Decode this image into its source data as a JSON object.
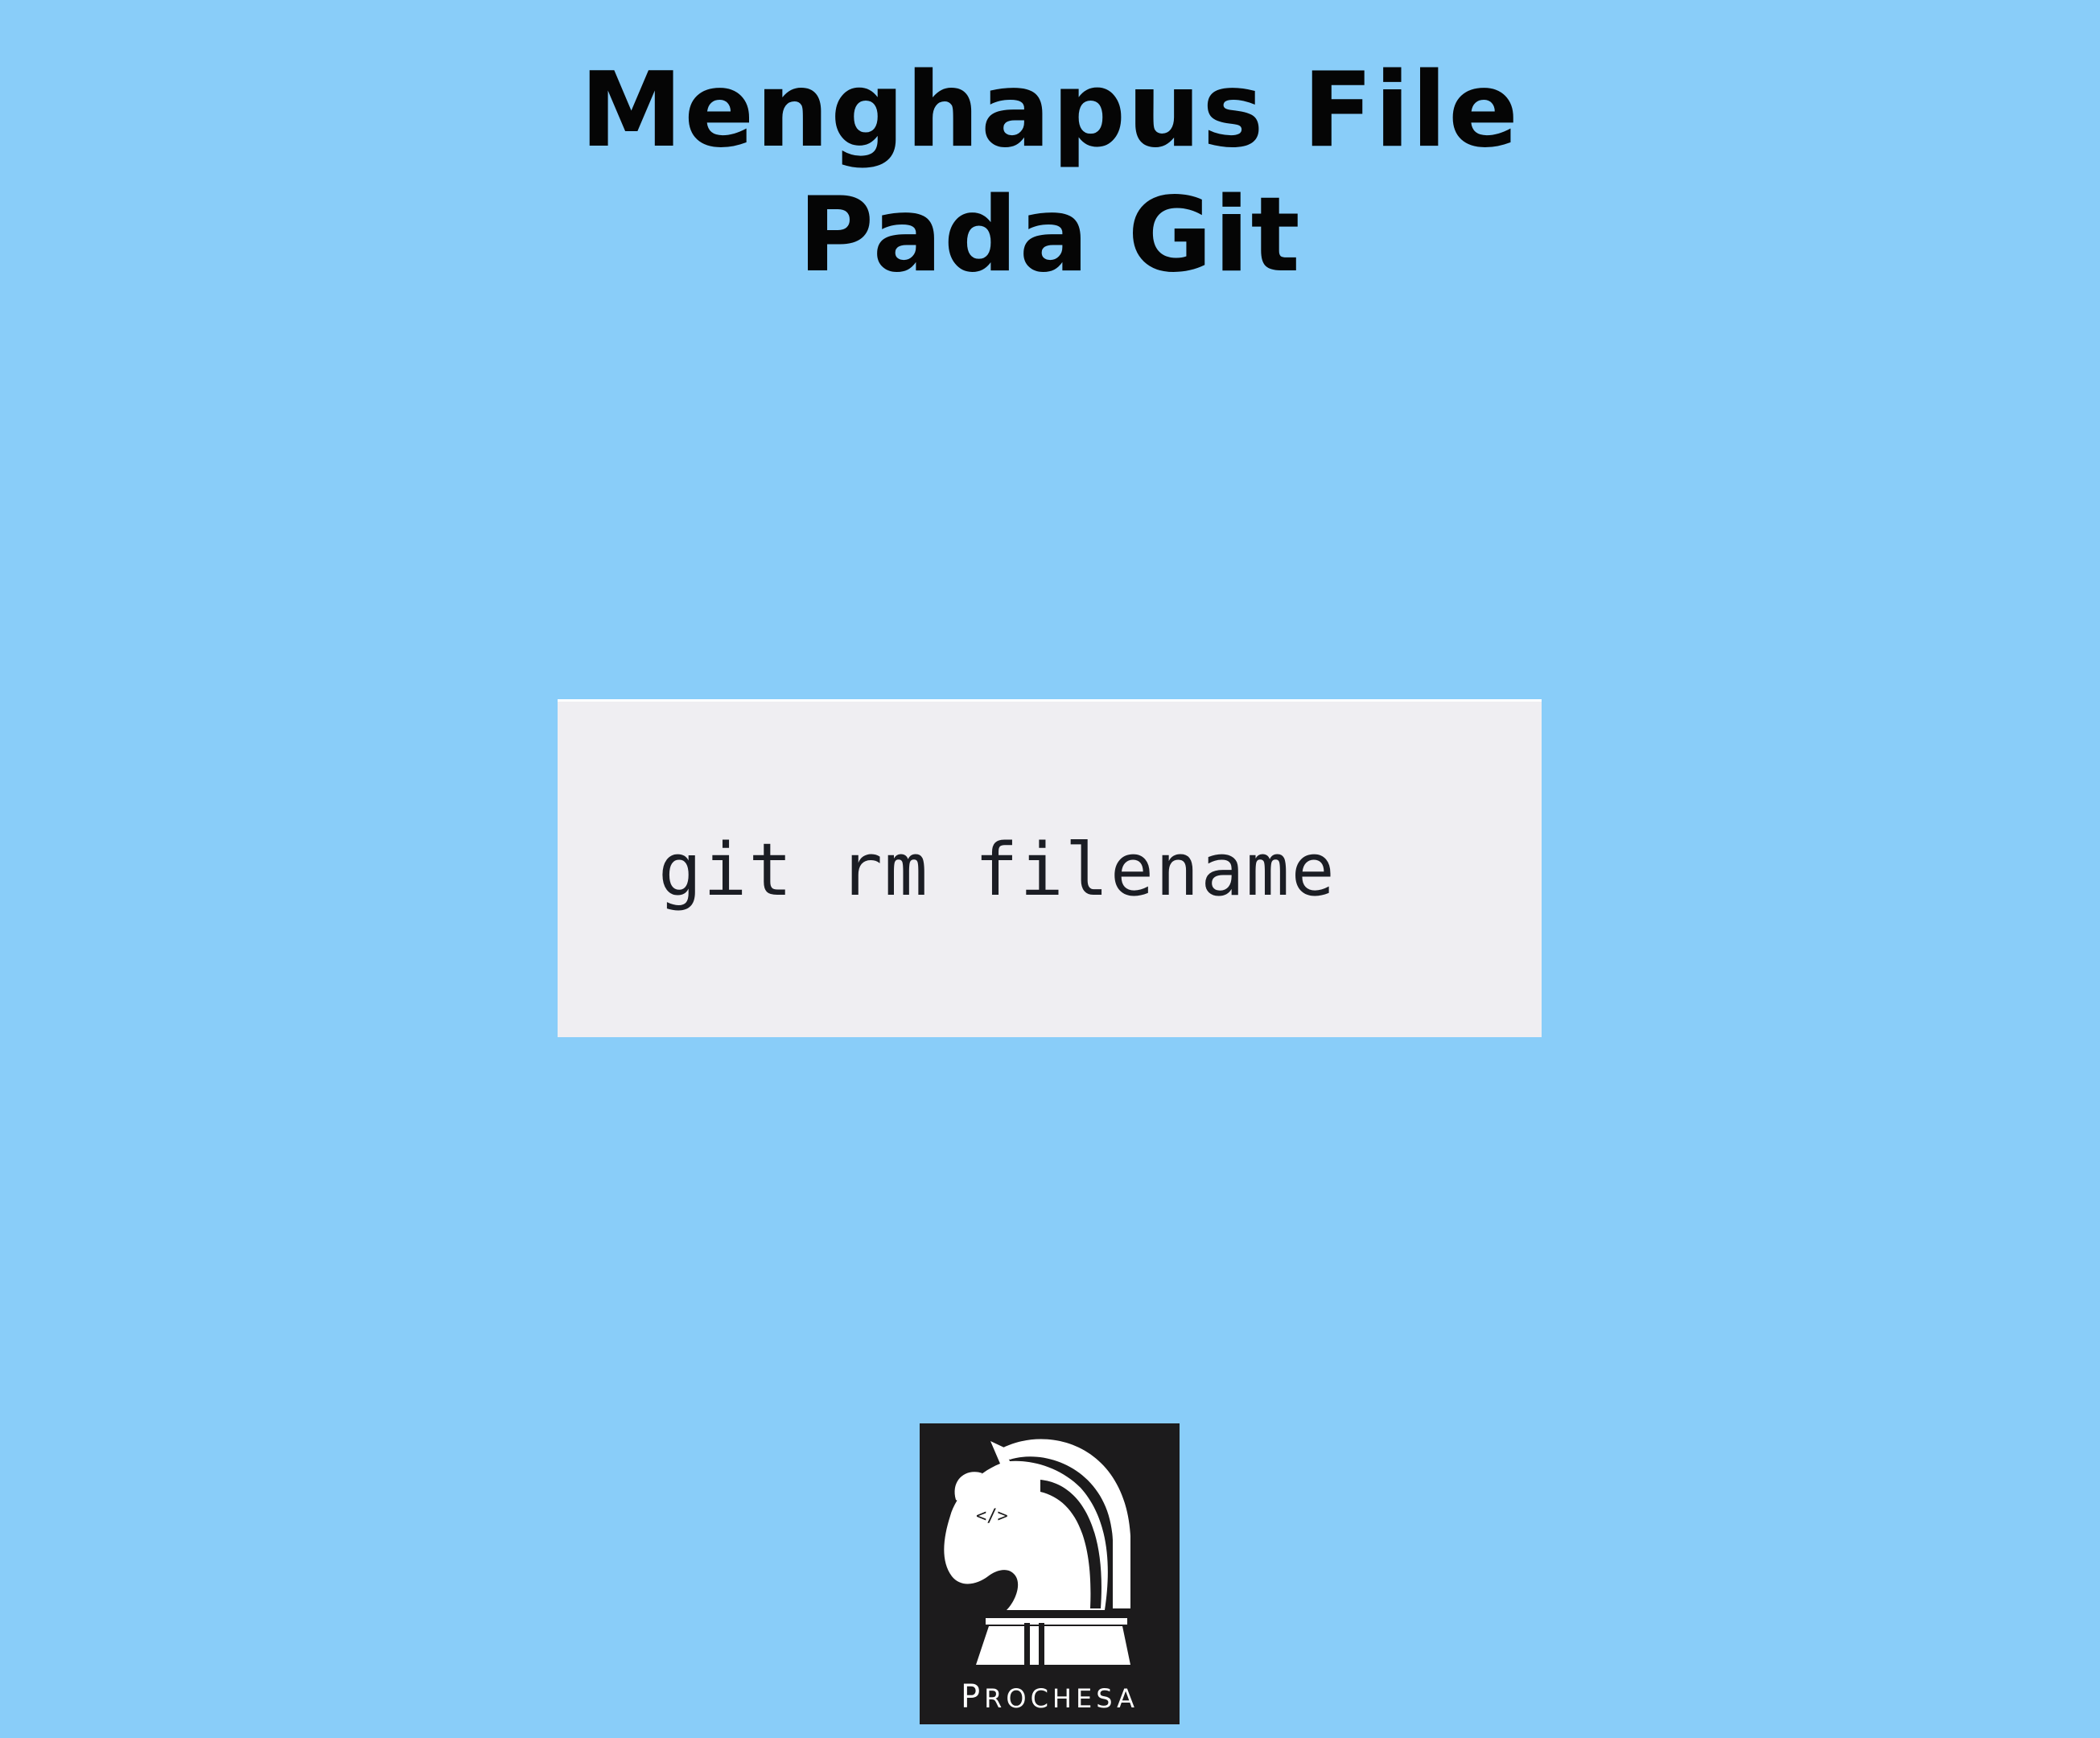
{
  "title": {
    "line1": "Menghapus File",
    "line2": "Pada Git"
  },
  "code": {
    "command": "git rm filename"
  },
  "logo": {
    "brand_first": "P",
    "brand_rest": "ROCHESA",
    "mark_text": "</>",
    "icon": "knight-chess-piece-icon"
  },
  "colors": {
    "background": "#89cdf9",
    "code_background": "#efeef2",
    "logo_background": "#1c1b1c"
  }
}
